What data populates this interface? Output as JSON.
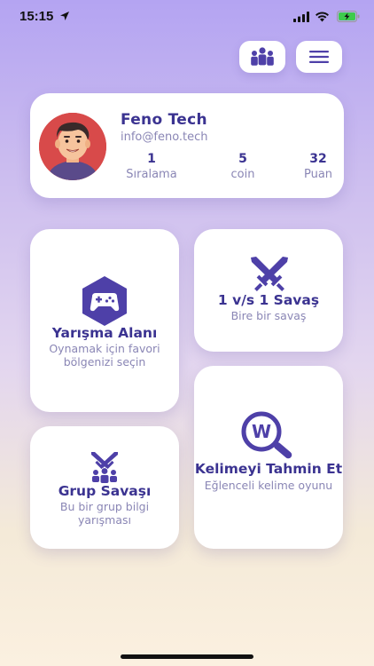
{
  "status": {
    "time": "15:15"
  },
  "colors": {
    "accent": "#3b3391",
    "subtext": "#8a86b5",
    "icon": "#4e40a8"
  },
  "header": {
    "users_icon": "users-group-icon",
    "menu_icon": "hamburger-menu-icon"
  },
  "profile": {
    "name": "Feno Tech",
    "email": "info@feno.tech",
    "stats": [
      {
        "value": "1",
        "label": "Sıralama"
      },
      {
        "value": "5",
        "label": "coin"
      },
      {
        "value": "32",
        "label": "Puan"
      }
    ]
  },
  "tiles": {
    "competition": {
      "title": "Yarışma Alanı",
      "subtitle": "Oynamak için favori bölgenizi seçin",
      "icon": "gamepad-hexagon-icon"
    },
    "duel": {
      "title": "1 v/s 1 Savaş",
      "subtitle": "Bire bir savaş",
      "icon": "crossed-swords-icon"
    },
    "group": {
      "title": "Grup Savaşı",
      "subtitle": "Bu bir grup bilgi yarışması",
      "icon": "group-battle-icon"
    },
    "guess": {
      "title": "Kelimeyi Tahmin Et",
      "subtitle": "Eğlenceli kelime oyunu",
      "icon": "word-search-icon"
    }
  }
}
